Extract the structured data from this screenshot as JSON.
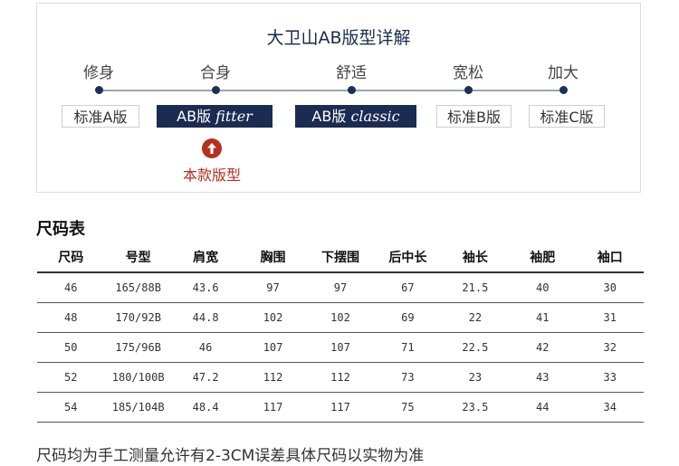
{
  "fit_guide": {
    "title": "大卫山AB版型详解",
    "points": [
      "修身",
      "合身",
      "舒适",
      "宽松",
      "加大"
    ],
    "boxes": [
      {
        "text": "标准A版",
        "italic": "",
        "style": "outline"
      },
      {
        "text": "AB版 ",
        "italic": "fitter",
        "style": "filled"
      },
      {
        "text": "AB版 ",
        "italic": "classic",
        "style": "filled"
      },
      {
        "text": "标准B版",
        "italic": "",
        "style": "outline"
      },
      {
        "text": "标准C版",
        "italic": "",
        "style": "outline"
      }
    ],
    "current_label": "本款版型",
    "colors": {
      "navy": "#1b2b52",
      "accent": "#b5301f"
    },
    "current_marker_icon": "up-arrow-circle-icon"
  },
  "size_table": {
    "title": "尺码表",
    "headers": [
      "尺码",
      "号型",
      "肩宽",
      "胸围",
      "下摆围",
      "后中长",
      "袖长",
      "袖肥",
      "袖口"
    ],
    "rows": [
      [
        "46",
        "165/88B",
        "43.6",
        "97",
        "97",
        "67",
        "21.5",
        "40",
        "30"
      ],
      [
        "48",
        "170/92B",
        "44.8",
        "102",
        "102",
        "69",
        "22",
        "41",
        "31"
      ],
      [
        "50",
        "175/96B",
        "46",
        "107",
        "107",
        "71",
        "22.5",
        "42",
        "32"
      ],
      [
        "52",
        "180/100B",
        "47.2",
        "112",
        "112",
        "73",
        "23",
        "43",
        "33"
      ],
      [
        "54",
        "185/104B",
        "48.4",
        "117",
        "117",
        "75",
        "23.5",
        "44",
        "34"
      ]
    ]
  },
  "footnote": "尺码均为手工测量允许有2-3CM误差具体尺码以实物为准"
}
